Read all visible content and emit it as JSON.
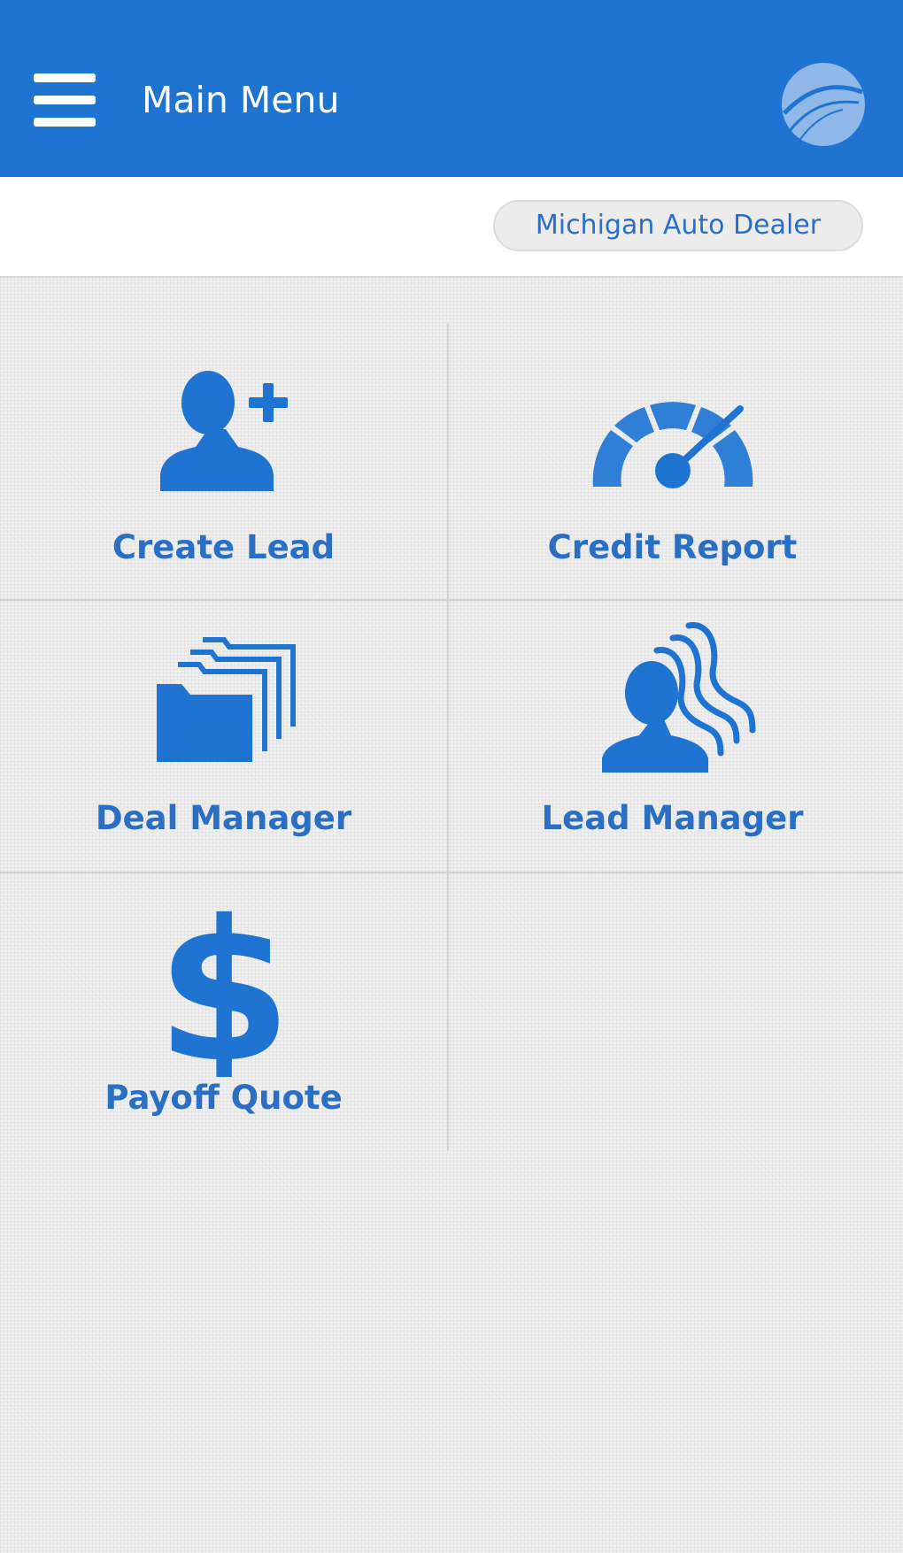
{
  "header": {
    "title": "Main Menu",
    "menu_icon": "hamburger-menu-icon",
    "logo_icon": "app-logo-icon",
    "color": "#1e74d0"
  },
  "dealer": {
    "name": "Michigan Auto Dealer"
  },
  "tiles": [
    {
      "label": "Create Lead",
      "icon": "add-user-icon"
    },
    {
      "label": "Credit Report",
      "icon": "speedometer-icon"
    },
    {
      "label": "Deal Manager",
      "icon": "folders-icon"
    },
    {
      "label": "Lead Manager",
      "icon": "users-group-icon"
    },
    {
      "label": "Payoff Quote",
      "icon": "dollar-icon"
    }
  ],
  "theme": {
    "accent": "#1e74d0",
    "label_color": "#2a6fc4"
  }
}
